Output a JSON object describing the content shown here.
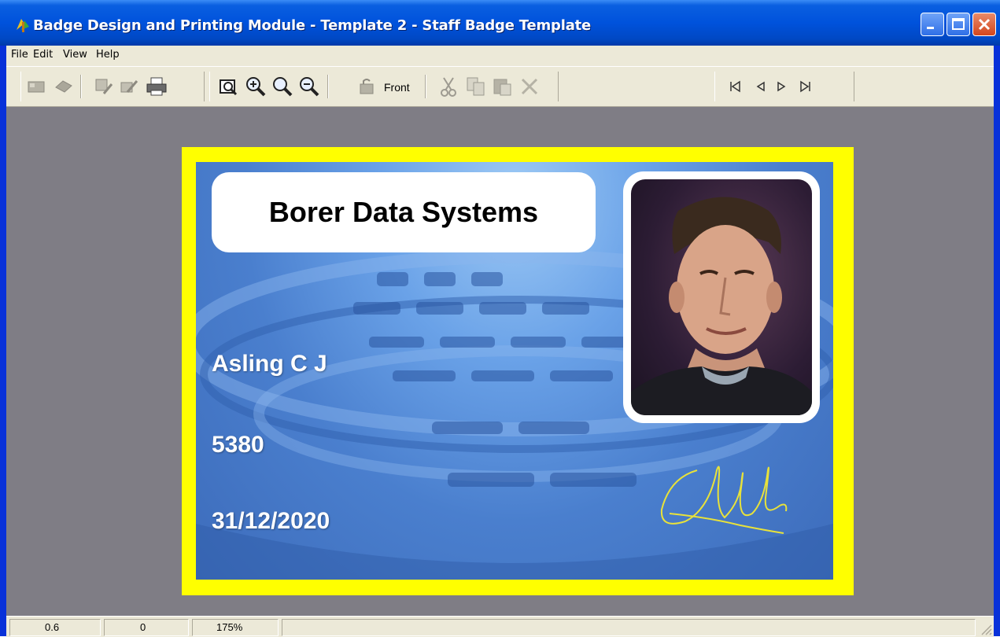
{
  "window": {
    "title": "Badge Design and Printing Module - Template 2 - Staff Badge Template",
    "icon": "app-icon",
    "controls": [
      "minimize-icon",
      "maximize-icon",
      "close-icon"
    ]
  },
  "menu": {
    "file": "File",
    "edit": "Edit",
    "view": "View",
    "help": "Help"
  },
  "toolbar": {
    "front_label": "Front",
    "icons": [
      "card-icon",
      "eraser-icon",
      "card-edit-icon",
      "card-write-icon",
      "printer-icon",
      "zoom-page-icon",
      "zoom-in-icon",
      "zoom-icon",
      "zoom-out-icon",
      "flip-card-icon",
      "cut-icon",
      "copy-icon",
      "paste-icon",
      "delete-icon",
      "first-record-icon",
      "previous-record-icon",
      "next-record-icon",
      "last-record-icon"
    ]
  },
  "badge": {
    "company": "Borer Data Systems",
    "name": "Asling C J",
    "number": "5380",
    "expiry": "31/12/2020",
    "border_color": "#ffff00"
  },
  "status": {
    "x": "0.6",
    "y": "0",
    "zoom": "175%"
  }
}
